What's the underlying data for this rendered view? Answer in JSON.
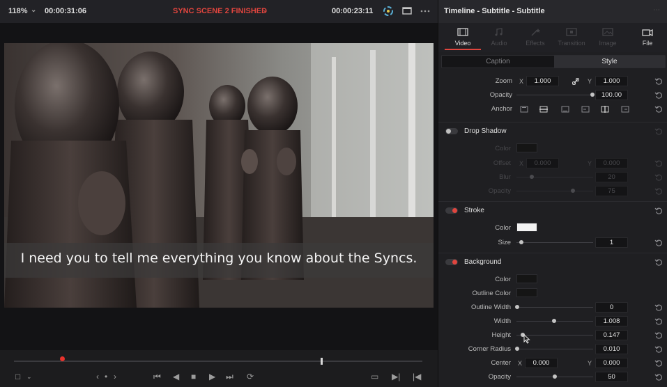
{
  "viewer": {
    "zoom": "118%",
    "source_timecode": "00:00:31:06",
    "clip_title": "SYNC SCENE 2 FINISHED",
    "record_timecode": "00:00:23:11",
    "subtitle_text": "I need you to tell me everything you know about the Syncs."
  },
  "inspector": {
    "title": "Timeline - Subtitle - Subtitle",
    "tabs": [
      {
        "label": "Video",
        "state": "active"
      },
      {
        "label": "Audio",
        "state": "disabled"
      },
      {
        "label": "Effects",
        "state": "disabled"
      },
      {
        "label": "Transition",
        "state": "disabled"
      },
      {
        "label": "Image",
        "state": "disabled"
      },
      {
        "label": "File",
        "state": "enabled"
      }
    ],
    "segments": {
      "caption": "Caption",
      "style": "Style",
      "selected": "Style"
    },
    "top_rows": {
      "zoom_label": "Zoom",
      "x_label": "X",
      "zoom_x": "1.000",
      "y_label": "Y",
      "zoom_y": "1.000",
      "opacity_label": "Opacity",
      "opacity_value": "100.00",
      "opacity_level": 1.0,
      "anchor_label": "Anchor"
    },
    "drop_shadow": {
      "title": "Drop Shadow",
      "enabled": false,
      "color_label": "Color",
      "color": "#151515",
      "offset_label": "Offset",
      "x_label": "X",
      "offset_x": "0.000",
      "y_label": "Y",
      "offset_y": "0.000",
      "blur_label": "Blur",
      "blur_value": "20",
      "opacity_label": "Opacity",
      "opacity_value": "75"
    },
    "stroke": {
      "title": "Stroke",
      "enabled": true,
      "color_label": "Color",
      "color": "#f2f2f2",
      "size_label": "Size",
      "size_value": "1"
    },
    "background": {
      "title": "Background",
      "enabled": true,
      "color_label": "Color",
      "color": "#151515",
      "outline_color_label": "Outline Color",
      "outline_color": "#151515",
      "outline_width_label": "Outline Width",
      "outline_width_value": "0",
      "width_label": "Width",
      "width_value": "1.008",
      "height_label": "Height",
      "height_value": "0.147",
      "corner_radius_label": "Corner Radius",
      "corner_radius_value": "0.010",
      "center_label": "Center",
      "x_label": "X",
      "center_x": "0.000",
      "y_label": "Y",
      "center_y": "0.000",
      "opacity_label": "Opacity",
      "opacity_value": "50"
    }
  },
  "colors": {
    "accent_red": "#e0453e",
    "panel_bg": "#1f1f22",
    "field_bg": "#141416"
  }
}
